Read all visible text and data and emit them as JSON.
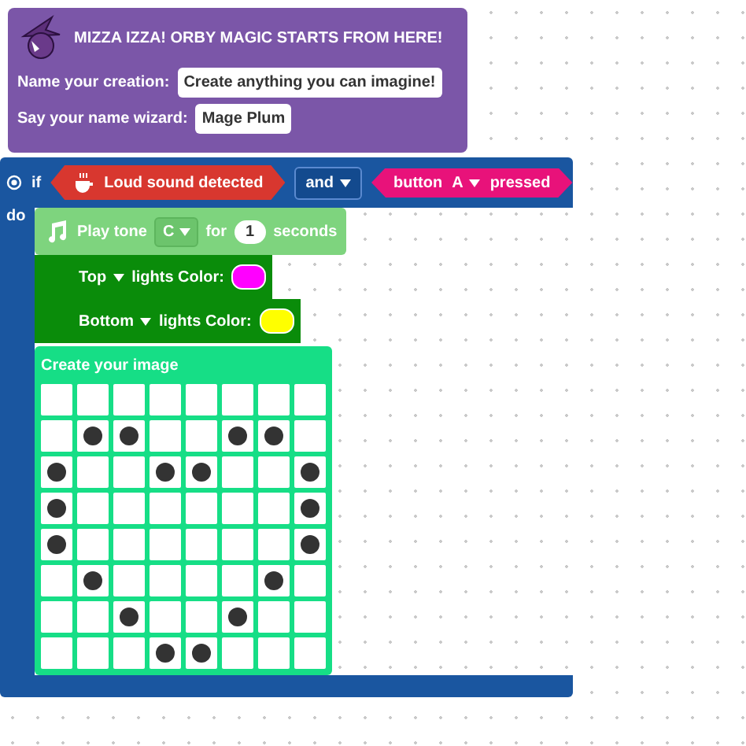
{
  "header": {
    "title": "MIZZA IZZA! ORBY MAGIC STARTS FROM HERE!",
    "fields": [
      {
        "label": "Name your creation:",
        "value": "Create anything you can imagine!"
      },
      {
        "label": "Say your name wizard:",
        "value": "Mage Plum"
      }
    ]
  },
  "if_block": {
    "keyword": "if",
    "do_label": "do",
    "condition_left": {
      "label": "Loud sound detected"
    },
    "operator": "and",
    "condition_right": {
      "prefix": "button",
      "button": "A",
      "suffix": "pressed"
    }
  },
  "statements": [
    {
      "kind": "tone",
      "label": "Play tone",
      "note": "C",
      "for_label": "for",
      "duration": "1",
      "unit": "seconds"
    },
    {
      "kind": "lights",
      "position": "Top",
      "label": "lights Color:",
      "color": "#ff00ff"
    },
    {
      "kind": "lights",
      "position": "Bottom",
      "label": "lights Color:",
      "color": "#ffff00"
    },
    {
      "kind": "image",
      "title": "Create your image",
      "rows": [
        [
          false,
          false,
          false,
          false,
          false,
          false,
          false,
          false
        ],
        [
          false,
          true,
          true,
          false,
          false,
          true,
          true,
          false
        ],
        [
          true,
          false,
          false,
          true,
          true,
          false,
          false,
          true
        ],
        [
          true,
          false,
          false,
          false,
          false,
          false,
          false,
          true
        ],
        [
          true,
          false,
          false,
          false,
          false,
          false,
          false,
          true
        ],
        [
          false,
          true,
          false,
          false,
          false,
          false,
          true,
          false
        ],
        [
          false,
          false,
          true,
          false,
          false,
          true,
          false,
          false
        ],
        [
          false,
          false,
          false,
          true,
          true,
          false,
          false,
          false
        ]
      ]
    }
  ]
}
